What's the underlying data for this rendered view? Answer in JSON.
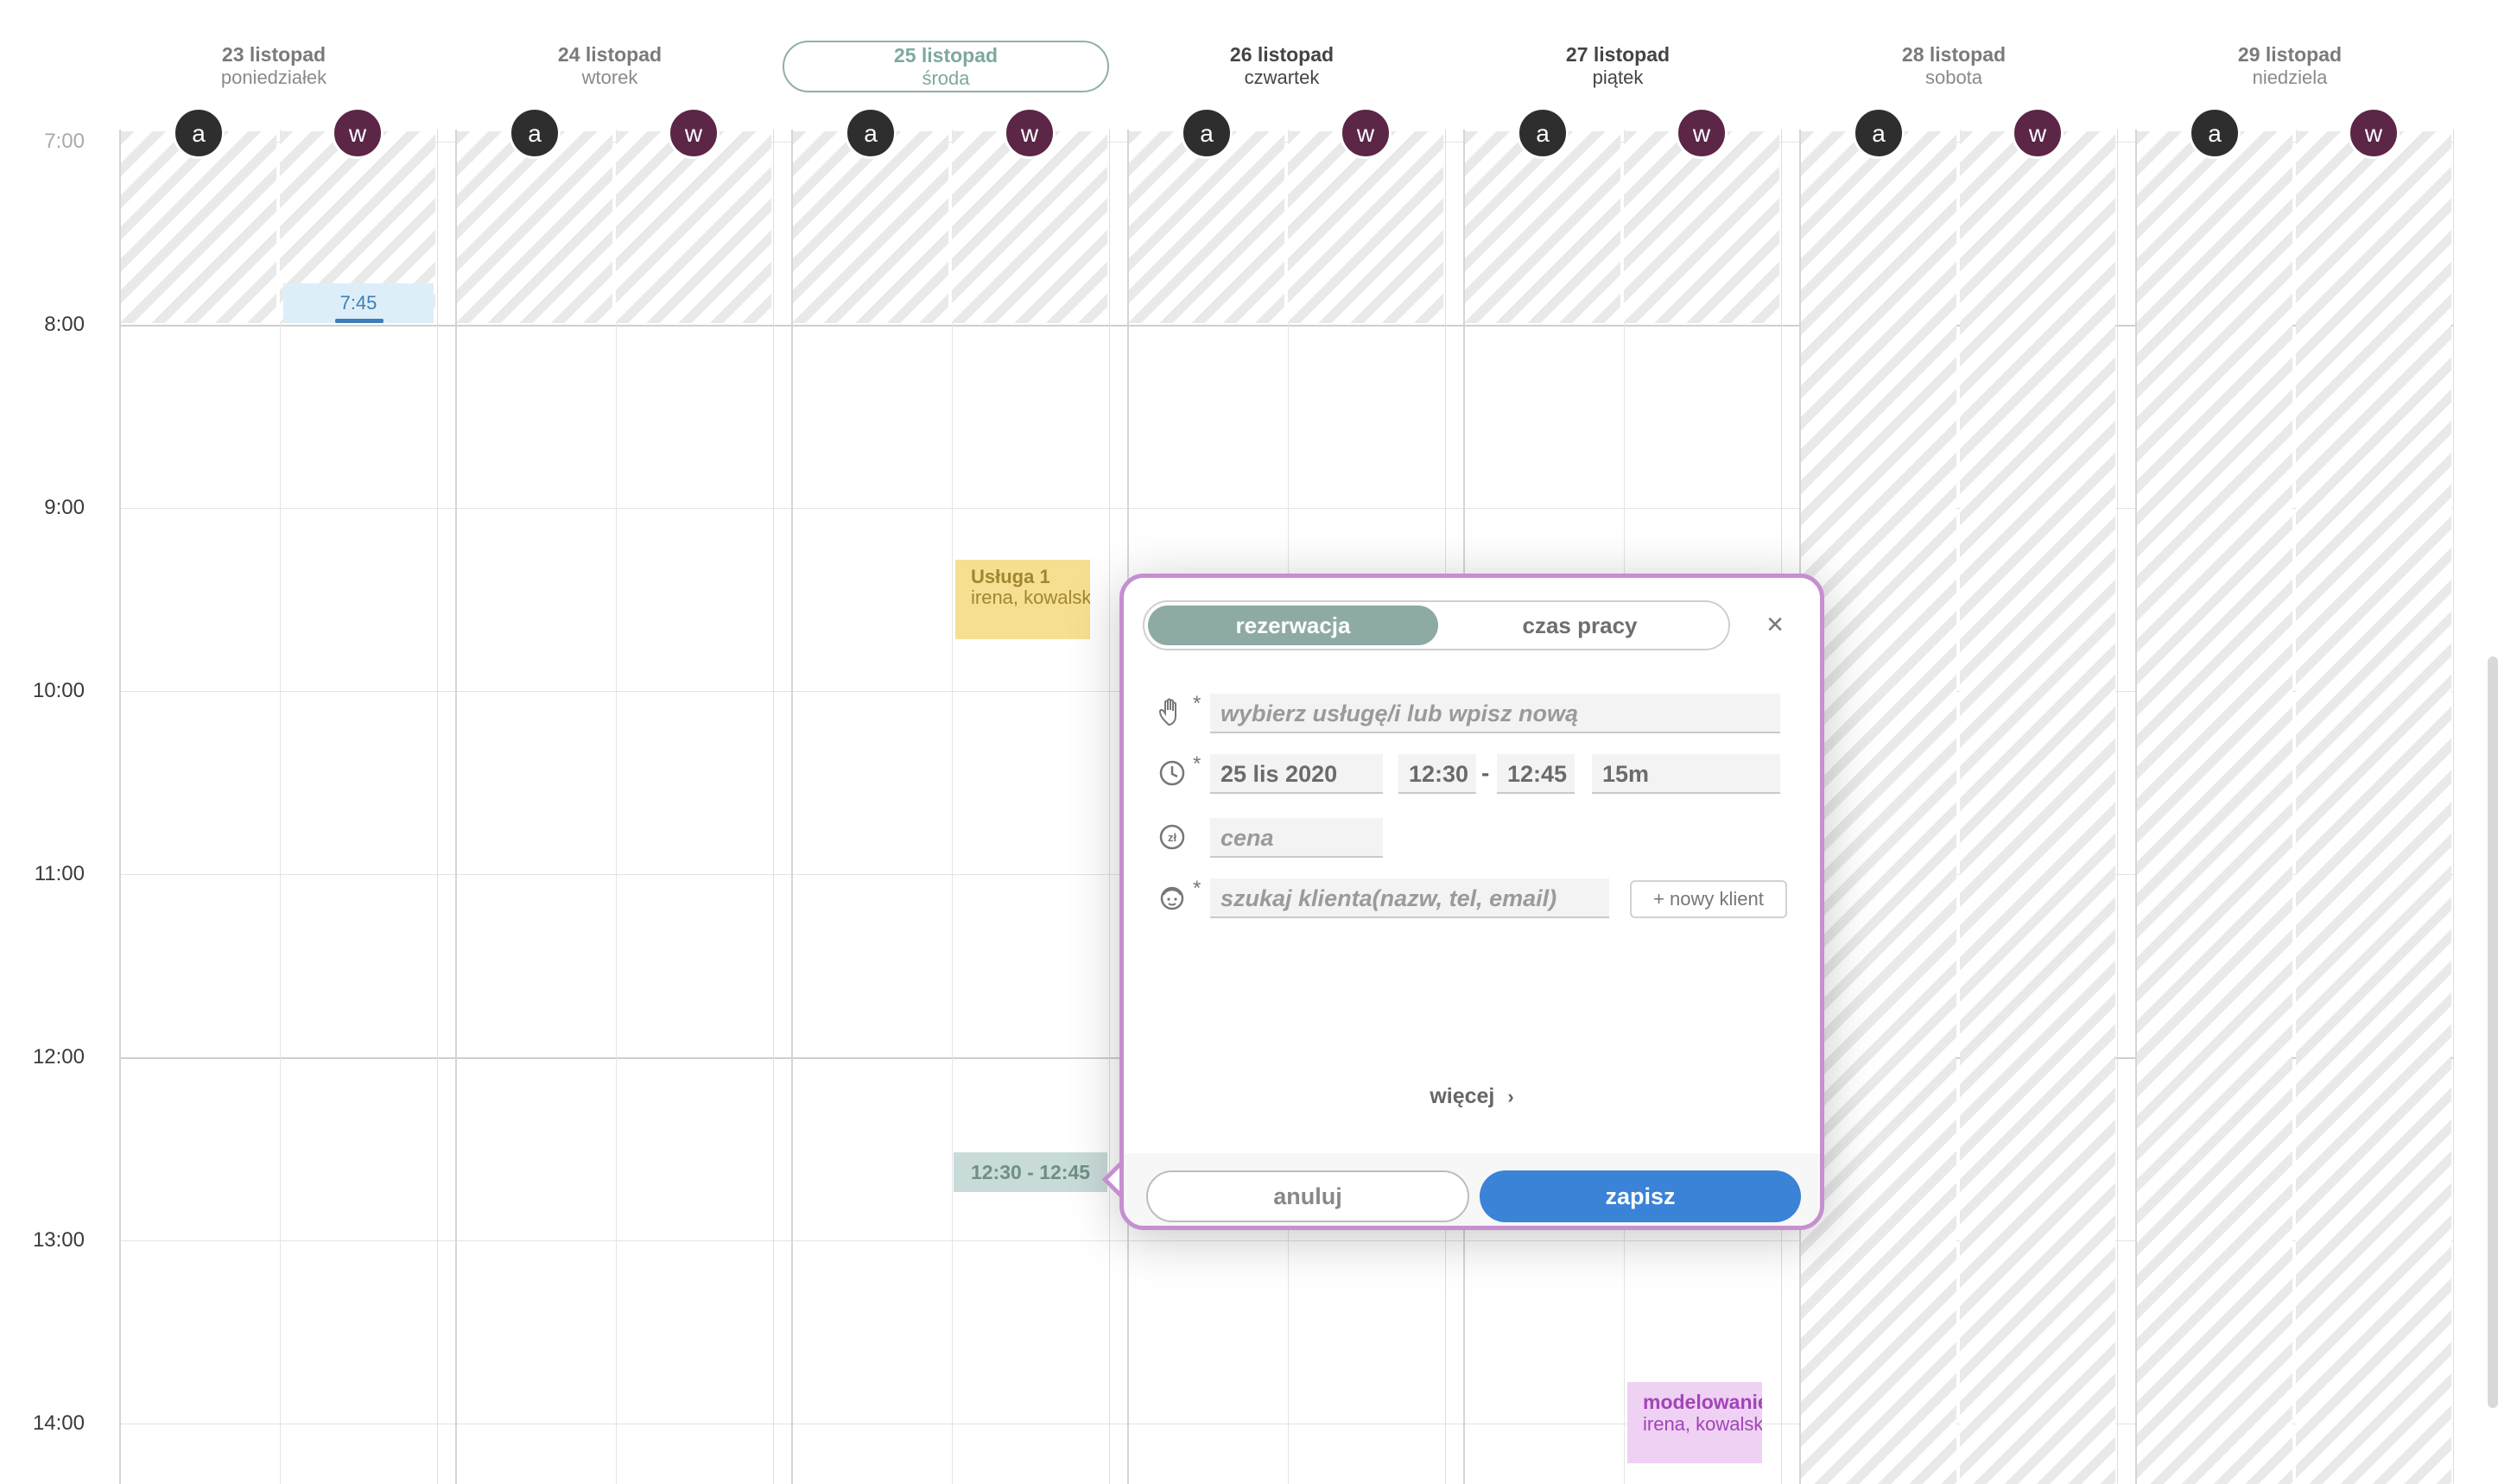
{
  "days": [
    {
      "date": "23 listopad",
      "weekday": "poniedziałek"
    },
    {
      "date": "24 listopad",
      "weekday": "wtorek"
    },
    {
      "date": "25 listopad",
      "weekday": "środa",
      "today": true
    },
    {
      "date": "26 listopad",
      "weekday": "czwartek"
    },
    {
      "date": "27 listopad",
      "weekday": "piątek"
    },
    {
      "date": "28 listopad",
      "weekday": "sobota"
    },
    {
      "date": "29 listopad",
      "weekday": "niedziela"
    }
  ],
  "staff": [
    {
      "initial": "a",
      "color": "#2e2e2e"
    },
    {
      "initial": "w",
      "color": "#5c2647"
    }
  ],
  "times": [
    "7:00",
    "8:00",
    "9:00",
    "10:00",
    "11:00",
    "12:00",
    "13:00",
    "14:00"
  ],
  "events": {
    "e745": {
      "label": "7:45"
    },
    "usluga": {
      "title": "Usługa 1",
      "client": "irena, kowalska"
    },
    "new_slot": {
      "label": "12:30 - 12:45"
    },
    "modelowanie": {
      "title": "modelowanie",
      "client": "irena, kowalska"
    }
  },
  "popup": {
    "tab_reservation": "rezerwacja",
    "tab_work_time": "czas pracy",
    "close_symbol": "×",
    "required_mark": "*",
    "service_placeholder": "wybierz usługę/i lub wpisz nową",
    "date": "25 lis 2020",
    "time_from": "12:30",
    "time_sep": "-",
    "time_to": "12:45",
    "duration": "15m",
    "price_placeholder": "cena",
    "client_placeholder": "szukaj klienta(nazw, tel, email)",
    "new_client": "+ nowy klient",
    "more": "więcej",
    "cancel": "anuluj",
    "save": "zapisz"
  },
  "colors": {
    "accent_teal": "#8eaaa5",
    "save_blue": "#3a83d6",
    "popup_border": "#c58fd0"
  }
}
